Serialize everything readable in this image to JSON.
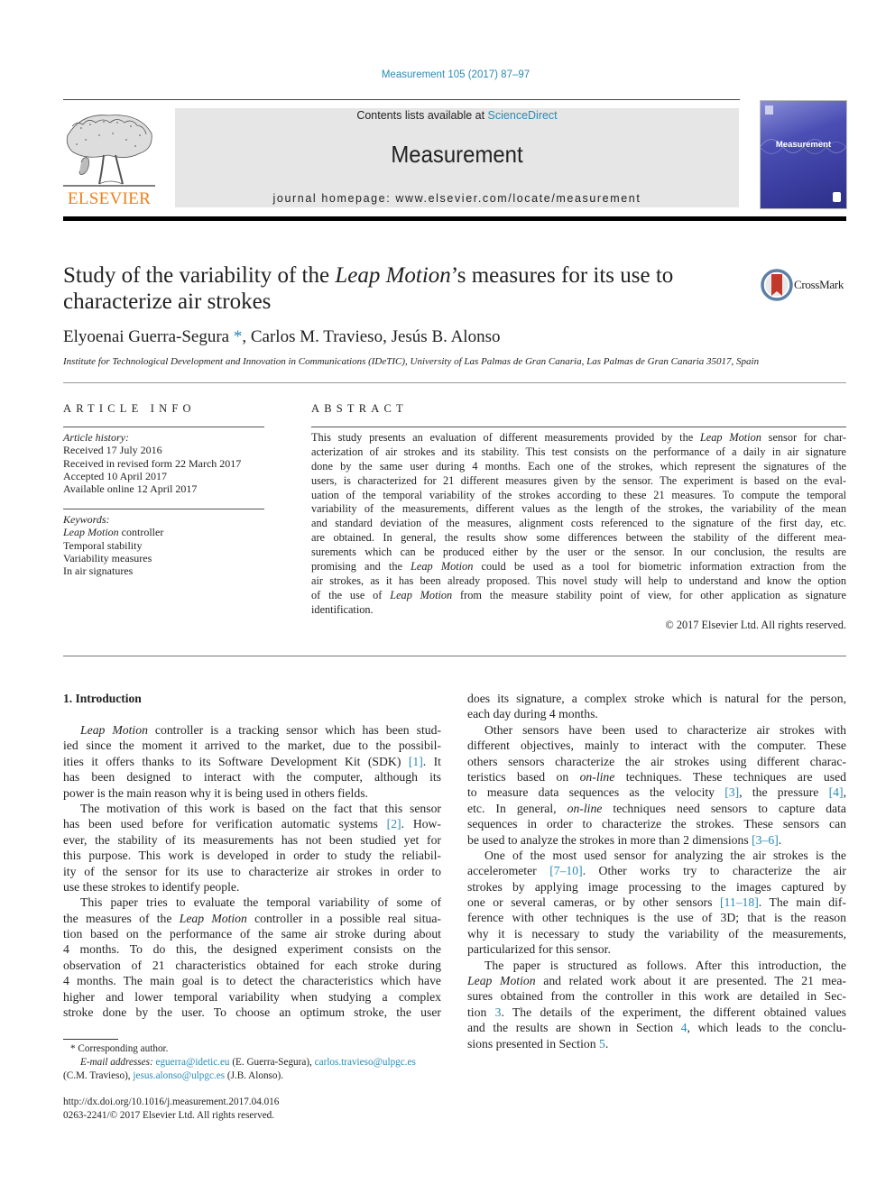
{
  "header": {
    "journal_ref": "Measurement 105 (2017) 87–97",
    "contents_prefix": "Contents lists available at ",
    "contents_link": "ScienceDirect",
    "journal_title": "Measurement",
    "homepage": "journal homepage: www.elsevier.com/locate/measurement",
    "publisher_logo_text": "ELSEVIER",
    "cover_title": "Measurement",
    "colors": {
      "link": "#2a8ab5",
      "elsevier_orange": "#f07f1b",
      "banner_bg": "#e6e6e6"
    }
  },
  "article": {
    "title_part1": "Study of the variability of the ",
    "title_italic": "Leap Motion",
    "title_part2": "’s measures for its use to",
    "title_line2": "characterize air strokes",
    "crossmark_label": "CrossMark",
    "authors": [
      {
        "name": "Elyoenai Guerra-Segura",
        "mark": "*"
      },
      {
        "name": "Carlos M. Travieso"
      },
      {
        "name": "Jesús B. Alonso"
      }
    ],
    "affiliation": "Institute for Technological Development and Innovation in Communications (IDeTIC), University of Las Palmas de Gran Canaria, Las Palmas de Gran Canaria 35017, Spain"
  },
  "article_info": {
    "heading": "ARTICLE INFO",
    "history_label": "Article history:",
    "history": [
      "Received 17 July 2016",
      "Received in revised form 22 March 2017",
      "Accepted 10 April 2017",
      "Available online 12 April 2017"
    ],
    "keywords_label": "Keywords:",
    "keywords": [
      {
        "italic": "Leap Motion",
        "rest": " controller"
      },
      {
        "italic": "",
        "rest": "Temporal stability"
      },
      {
        "italic": "",
        "rest": "Variability measures"
      },
      {
        "italic": "",
        "rest": "In air signatures"
      }
    ]
  },
  "abstract": {
    "heading": "ABSTRACT",
    "lines": [
      [
        "This study presents an evaluation of different measurements provided by the ",
        "Leap Motion",
        " sensor for char-"
      ],
      [
        "acterization of air strokes and its stability. This test consists on the performance of a daily in air signature"
      ],
      [
        "done by the same user during 4 months. Each one of the strokes, which represent the signatures of the"
      ],
      [
        "users, is characterized for 21 different measures given by the sensor. The experiment is based on the eval-"
      ],
      [
        "uation of the temporal variability of the strokes according to these 21 measures. To compute the temporal"
      ],
      [
        "variability of the measurements, different values as the length of the strokes, the variability of the mean"
      ],
      [
        "and standard deviation of the measures, alignment costs referenced to the signature of the first day, etc."
      ],
      [
        "are obtained. In general, the results show some differences between the stability of the different mea-"
      ],
      [
        "surements which can be produced either by the user or the sensor. In our conclusion, the results are"
      ],
      [
        "promising and the ",
        "Leap Motion",
        " could be used as a tool for biometric information extraction from the"
      ],
      [
        "air strokes, as it has been already proposed. This novel study will help to understand and know the option"
      ],
      [
        "of the use of ",
        "Leap Motion",
        " from the measure stability point of view, for other application as signature"
      ],
      [
        "identification."
      ]
    ],
    "copyright": "© 2017 Elsevier Ltd. All rights reserved."
  },
  "introduction": {
    "heading": "1. Introduction",
    "col1": [
      {
        "t": [
          "",
          "Leap Motion",
          " controller is a tracking sensor which has been stud-"
        ],
        "indent": true
      },
      {
        "t": [
          "ied since the moment it arrived to the market, due to the possibil-"
        ]
      },
      {
        "t": [
          "ities it offers thanks to its Software Development Kit (SDK) ",
          "[1]",
          ". It"
        ],
        "links": [
          1
        ]
      },
      {
        "t": [
          "has been designed to interact with the computer, although its"
        ]
      },
      {
        "t": [
          "power is the main reason why it is being used in others fields."
        ],
        "last": true
      },
      {
        "t": [
          "The motivation of this work is based on the fact that this sensor"
        ],
        "indent": true
      },
      {
        "t": [
          "has been used before for verification automatic systems ",
          "[2]",
          ". How-"
        ],
        "links": [
          1
        ]
      },
      {
        "t": [
          "ever, the stability of its measurements has not been studied yet for"
        ]
      },
      {
        "t": [
          "this purpose. This work is developed in order to study the reliabil-"
        ]
      },
      {
        "t": [
          "ity of the sensor for its use to characterize air strokes in order to"
        ]
      },
      {
        "t": [
          "use these strokes to identify people."
        ],
        "last": true
      },
      {
        "t": [
          "This paper tries to evaluate the temporal variability of some of"
        ],
        "indent": true
      },
      {
        "t": [
          "the measures of the ",
          "Leap Motion",
          " controller in a possible real situa-"
        ]
      },
      {
        "t": [
          "tion based on the performance of the same air stroke during about"
        ]
      },
      {
        "t": [
          "4 months. To do this, the designed experiment consists on the"
        ]
      },
      {
        "t": [
          "observation of 21 characteristics obtained for each stroke during"
        ]
      },
      {
        "t": [
          "4 months. The main goal is to detect the characteristics which have"
        ]
      },
      {
        "t": [
          "higher and lower temporal variability when studying a complex"
        ]
      },
      {
        "t": [
          "stroke done by the user. To choose an optimum stroke, the user"
        ]
      }
    ],
    "col2": [
      {
        "t": [
          "does its signature, a complex stroke which is natural for the person,"
        ]
      },
      {
        "t": [
          "each day during 4 months."
        ],
        "last": true
      },
      {
        "t": [
          "Other sensors have been used to characterize air strokes with"
        ],
        "indent": true
      },
      {
        "t": [
          "different objectives, mainly to interact with the computer. These"
        ]
      },
      {
        "t": [
          "others sensors characterize the air strokes using different charac-"
        ]
      },
      {
        "t": [
          "teristics based on ",
          "on-line",
          " techniques. These techniques are used"
        ]
      },
      {
        "t": [
          "to measure data sequences as the velocity ",
          "[3]",
          ", the pressure ",
          "[4]",
          ","
        ],
        "links": [
          1,
          3
        ]
      },
      {
        "t": [
          "etc. In general, ",
          "on-line",
          " techniques need sensors to capture data"
        ]
      },
      {
        "t": [
          "sequences in order to characterize the strokes. These sensors can"
        ]
      },
      {
        "t": [
          "be used to analyze the strokes in more than 2 dimensions ",
          "[3–6]",
          "."
        ],
        "links": [
          1
        ],
        "last": true
      },
      {
        "t": [
          "One of the most used sensor for analyzing the air strokes is the"
        ],
        "indent": true
      },
      {
        "t": [
          "accelerometer ",
          "[7–10]",
          ". Other works try to characterize the air"
        ],
        "links": [
          1
        ]
      },
      {
        "t": [
          "strokes by applying image processing to the images captured by"
        ]
      },
      {
        "t": [
          "one or several cameras, or by other sensors ",
          "[11–18]",
          ". The main dif-"
        ],
        "links": [
          1
        ]
      },
      {
        "t": [
          "ference with other techniques is the use of 3D; that is the reason"
        ]
      },
      {
        "t": [
          "why it is necessary to study the variability of the measurements,"
        ]
      },
      {
        "t": [
          "particularized for this sensor."
        ],
        "last": true
      },
      {
        "t": [
          "The paper is structured as follows. After this introduction, the"
        ],
        "indent": true
      },
      {
        "t": [
          "",
          "Leap Motion",
          " and related work about it are presented. The 21 mea-"
        ]
      },
      {
        "t": [
          "sures obtained from the controller in this work are detailed in Sec-"
        ]
      },
      {
        "t": [
          "tion ",
          "3",
          ". The details of the experiment, the different obtained values"
        ],
        "links": [
          1
        ]
      },
      {
        "t": [
          "and the results are shown in Section ",
          "4",
          ", which leads to the conclu-"
        ],
        "links": [
          1
        ]
      },
      {
        "t": [
          "sions presented in Section ",
          "5",
          "."
        ],
        "links": [
          1
        ],
        "last": true
      }
    ]
  },
  "footnotes": {
    "corresponding": "*  Corresponding author.",
    "email_label": "E-mail addresses: ",
    "emails": [
      {
        "addr": "eguerra@idetic.eu",
        "who": " (E. Guerra-Segura), "
      },
      {
        "addr": "carlos.travieso@ulpgc.es",
        "who": ""
      },
      {
        "addr": "jesus.alonso@ulpgc.es",
        "who": " (J.B. Alonso)."
      }
    ],
    "travieso_who": "(C.M. Travieso), ",
    "doi": "http://dx.doi.org/10.1016/j.measurement.2017.04.016",
    "issn": "0263-2241/© 2017 Elsevier Ltd. All rights reserved."
  }
}
